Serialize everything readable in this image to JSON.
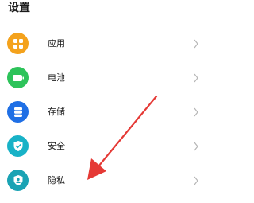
{
  "header": {
    "title": "设置"
  },
  "settings": {
    "items": [
      {
        "label": "应用",
        "icon": "apps-grid-icon",
        "color": "#F4A21C"
      },
      {
        "label": "电池",
        "icon": "battery-icon",
        "color": "#2DC35A"
      },
      {
        "label": "存储",
        "icon": "storage-icon",
        "color": "#1F6FE5"
      },
      {
        "label": "安全",
        "icon": "security-shield-icon",
        "color": "#18B2C7"
      },
      {
        "label": "隐私",
        "icon": "privacy-shield-icon",
        "color": "#1AA3B4"
      }
    ]
  },
  "annotation": {
    "icon": "red-arrow-pointer",
    "color": "#E53935"
  }
}
